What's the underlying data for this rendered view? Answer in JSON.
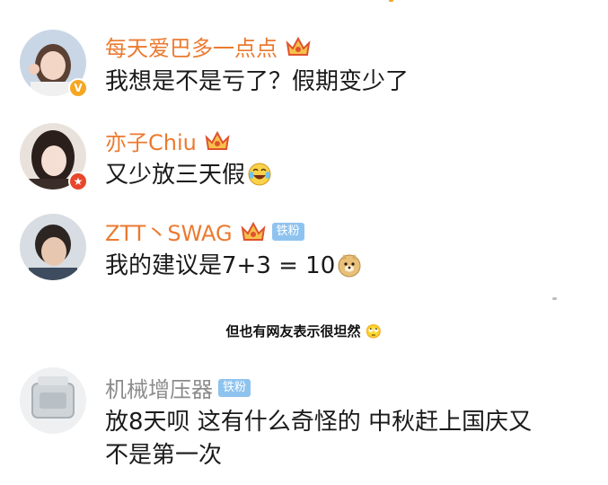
{
  "comments": [
    {
      "username": "每天爱巴多一点点",
      "text": "我想是不是亏了？假期变少了",
      "badge": "v"
    },
    {
      "username": "亦子Chiu",
      "text": "又少放三天假",
      "badge": "star"
    },
    {
      "username": "ZTT丶SWAG",
      "fan_tag": "铁粉",
      "text": "我的建议是7+3 = 10"
    },
    {
      "username": "机械增压器",
      "fan_tag": "铁粉",
      "text_line1": "放8天呗 这有什么奇怪的 中秋赶上国庆又",
      "text_line2": "不是第一次"
    }
  ],
  "caption": "但也有网友表示很坦然 🙄",
  "colors": {
    "username": "#eb7a30",
    "username_gray": "#8c8c8c",
    "fan_tag": "#8fc3ef"
  }
}
